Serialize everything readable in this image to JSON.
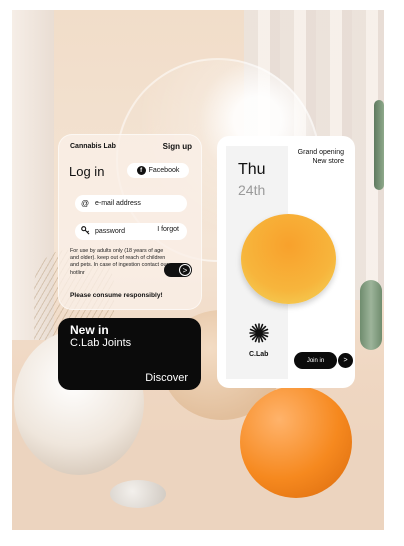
{
  "login": {
    "brand": "Cannabis Lab",
    "signup": "Sign up",
    "title": "Log in",
    "facebook": "Facebook",
    "email_label": "e-mail address",
    "password_label": "password",
    "forgot": "I forgot",
    "disclaimer": "For use by adults only (18 years of age and older). keep out of reach of children and pets. In case of ingestion contact our hotlinr",
    "consume": "Please consume responsibly!",
    "next": ">"
  },
  "news": {
    "title": "New in",
    "subtitle": "C.Lab Joints",
    "cta": "Discover"
  },
  "event": {
    "day": "Thu",
    "date": "24th",
    "line1": "Grand opening",
    "line2": "New store",
    "brand": "C.Lab",
    "join": "Join in",
    "arrow": ">"
  },
  "icons": {
    "facebook": "facebook-icon",
    "email": "at-icon",
    "password": "key-icon",
    "logo": "starburst-icon"
  },
  "colors": {
    "dark": "#0b0b0b",
    "accent_orange": "#f7a831"
  }
}
